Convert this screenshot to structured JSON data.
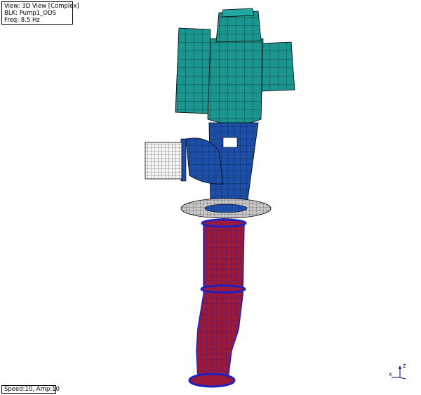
{
  "viewport": {
    "view_label": "View: 3D View [Complex]",
    "blk_label": "BLK: Pump1_ODS",
    "freq_label": "Freq: 8.5 Hz",
    "status_label": "Speed:10, Amp:10"
  },
  "triad": {
    "z_label": "Z",
    "x_label": "X",
    "axis_color": "#000080"
  },
  "colors": {
    "motor": "#1a9690",
    "discharge_head": "#1e4fa8",
    "column": "#9b1a3a",
    "column_rings": "#2020c0",
    "suction_flange": "#c8c8c8",
    "mesh_lines": "#000000"
  }
}
